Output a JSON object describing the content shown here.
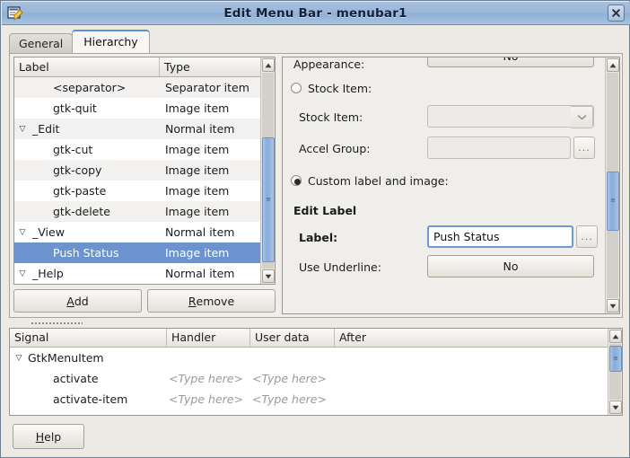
{
  "window": {
    "title": "Edit Menu Bar - menubar1",
    "icon": "window-edit-icon",
    "close_label": "✕"
  },
  "tabs": [
    {
      "label": "General",
      "active": false
    },
    {
      "label": "Hierarchy",
      "active": true
    }
  ],
  "tree": {
    "columns": [
      "Label",
      "Type"
    ],
    "rows": [
      {
        "label": "<separator>",
        "type": "Separator item",
        "indent": 1,
        "expander": "",
        "selected": false
      },
      {
        "label": "gtk-quit",
        "type": "Image item",
        "indent": 1,
        "expander": "",
        "selected": false
      },
      {
        "label": "_Edit",
        "type": "Normal item",
        "indent": 0,
        "expander": "▽",
        "selected": false
      },
      {
        "label": "gtk-cut",
        "type": "Image item",
        "indent": 1,
        "expander": "",
        "selected": false
      },
      {
        "label": "gtk-copy",
        "type": "Image item",
        "indent": 1,
        "expander": "",
        "selected": false
      },
      {
        "label": "gtk-paste",
        "type": "Image item",
        "indent": 1,
        "expander": "",
        "selected": false
      },
      {
        "label": "gtk-delete",
        "type": "Image item",
        "indent": 1,
        "expander": "",
        "selected": false
      },
      {
        "label": "_View",
        "type": "Normal item",
        "indent": 0,
        "expander": "▽",
        "selected": false
      },
      {
        "label": "Push Status",
        "type": "Image item",
        "indent": 1,
        "expander": "",
        "selected": true
      },
      {
        "label": "_Help",
        "type": "Normal item",
        "indent": 0,
        "expander": "▽",
        "selected": false
      }
    ],
    "scrollbar": {
      "up": "▲",
      "down": "▼",
      "grip": "≡"
    }
  },
  "tree_buttons": {
    "add": "Add",
    "add_mnemonic": "A",
    "remove": "Remove",
    "remove_mnemonic": "R"
  },
  "properties": {
    "appearance_label": "Appearance:",
    "appearance_value": "No",
    "stock_item_radio": "Stock Item:",
    "stock_item_label": "Stock Item:",
    "stock_item_value": "",
    "accel_group_label": "Accel Group:",
    "accel_group_value": "",
    "custom_radio": "Custom label and image:",
    "edit_label_heading": "Edit Label",
    "label_label": "Label:",
    "label_value": "Push Status",
    "dots": "...",
    "use_underline_label": "Use Underline:",
    "use_underline_value": "No",
    "combo_arrow": "⌄",
    "scrollbar": {
      "up": "▲",
      "down": "▼",
      "grip": "≡"
    }
  },
  "signals": {
    "columns": [
      "Signal",
      "Handler",
      "User data",
      "After"
    ],
    "rows": [
      {
        "expander": "▽",
        "signal": "GtkMenuItem",
        "indent": 0,
        "handler": "",
        "user_data": "",
        "after": ""
      },
      {
        "expander": "",
        "signal": "activate",
        "indent": 1,
        "handler": "<Type here>",
        "user_data": "<Type here>",
        "after": ""
      },
      {
        "expander": "",
        "signal": "activate-item",
        "indent": 1,
        "handler": "<Type here>",
        "user_data": "<Type here>",
        "after": ""
      }
    ],
    "scrollbar": {
      "up": "▲",
      "down": "▼",
      "grip": "≡"
    }
  },
  "footer": {
    "help": "Help",
    "help_mnemonic": "H"
  },
  "colors": {
    "selection": "#6c93cd",
    "titlebar": "#9ab6d9",
    "focus_border": "#6d9ad4"
  }
}
